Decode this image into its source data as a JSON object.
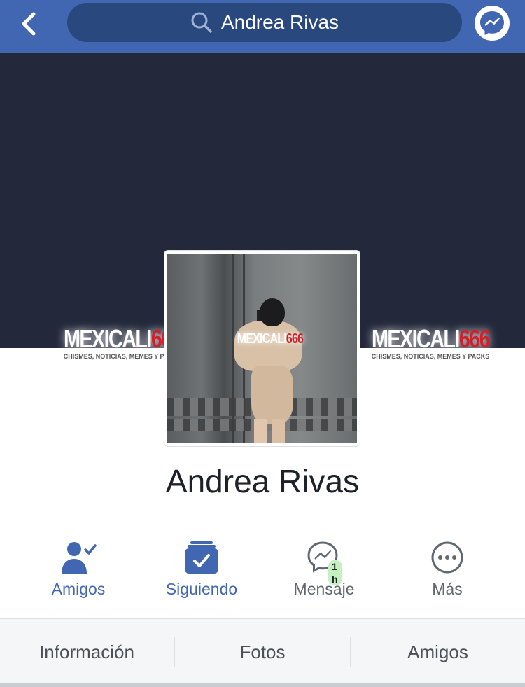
{
  "header": {
    "search_value": "Andrea Rivas",
    "icons": [
      "back-chevron-icon",
      "search-icon",
      "messenger-icon"
    ],
    "bar_color": "#4267b2"
  },
  "cover": {
    "background_color": "#23283a",
    "watermark": {
      "brand_white": "MEXICALI",
      "brand_red": "666",
      "tagline": "CHISMES, NOTICIAS, MEMES Y PACKS"
    }
  },
  "profile": {
    "name": "Andrea Rivas"
  },
  "actions": [
    {
      "label": "Amigos",
      "icon": "friends-check-icon",
      "color": "#4267b2"
    },
    {
      "label": "Siguiendo",
      "icon": "following-check-icon",
      "color": "#4267b2"
    },
    {
      "label": "Mensaje",
      "icon": "messenger-icon",
      "badge": "1 h",
      "color": "#606770"
    },
    {
      "label": "Más",
      "icon": "more-dots-icon",
      "color": "#606770"
    }
  ],
  "tabs": [
    {
      "label": "Información"
    },
    {
      "label": "Fotos"
    },
    {
      "label": "Amigos"
    }
  ]
}
